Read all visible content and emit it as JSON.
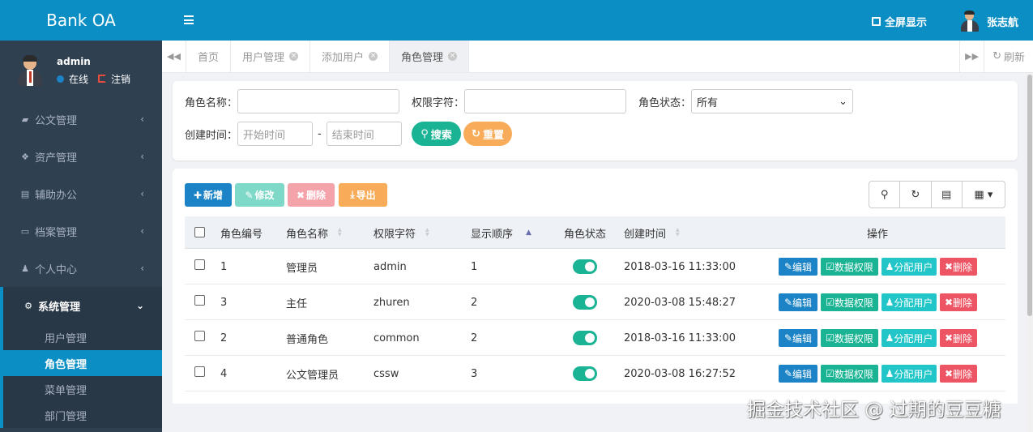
{
  "app": {
    "brand": "Bank OA"
  },
  "header": {
    "fullscreen_label": "全屏显示",
    "user_name": "张志航"
  },
  "profile": {
    "name": "admin",
    "status_online": "在线",
    "logout": "注销"
  },
  "sidebar": {
    "items": [
      {
        "label": "公文管理",
        "icon": "briefcase-icon"
      },
      {
        "label": "资产管理",
        "icon": "cubes-icon"
      },
      {
        "label": "辅助办公",
        "icon": "file-icon"
      },
      {
        "label": "档案管理",
        "icon": "inbox-icon"
      },
      {
        "label": "个人中心",
        "icon": "user-icon"
      },
      {
        "label": "系统管理",
        "icon": "gear-icon"
      }
    ],
    "subitems": [
      "用户管理",
      "角色管理",
      "菜单管理",
      "部门管理"
    ]
  },
  "tabs": [
    {
      "label": "首页"
    },
    {
      "label": "用户管理"
    },
    {
      "label": "添加用户"
    },
    {
      "label": "角色管理"
    }
  ],
  "tabs_refresh": "刷新",
  "search": {
    "role_name_label": "角色名称：",
    "role_key_label": "权限字符：",
    "status_label": "角色状态：",
    "status_value": "所有",
    "created_label": "创建时间：",
    "start_placeholder": "开始时间",
    "dash": "-",
    "end_placeholder": "结束时间",
    "search_btn": "搜索",
    "reset_btn": "重置"
  },
  "toolbar": {
    "add": "新增",
    "edit": "修改",
    "delete": "删除",
    "export": "导出"
  },
  "table": {
    "headers": [
      "角色编号",
      "角色名称",
      "权限字符",
      "显示顺序",
      "角色状态",
      "创建时间",
      "操作"
    ],
    "rows": [
      {
        "id": "1",
        "name": "管理员",
        "key": "admin",
        "sort": "1",
        "created": "2018-03-16 11:33:00"
      },
      {
        "id": "3",
        "name": "主任",
        "key": "zhuren",
        "sort": "2",
        "created": "2020-03-08 15:48:27"
      },
      {
        "id": "2",
        "name": "普通角色",
        "key": "common",
        "sort": "2",
        "created": "2018-03-16 11:33:00"
      },
      {
        "id": "4",
        "name": "公文管理员",
        "key": "cssw",
        "sort": "3",
        "created": "2020-03-08 16:27:52"
      }
    ],
    "actions": {
      "edit": "编辑",
      "data_scope": "数据权限",
      "assign_user": "分配用户",
      "delete": "删除"
    }
  },
  "watermark": "掘金技术社区 @ 过期的豆豆糖",
  "colors": {
    "primary": "#0a8ec4",
    "sidebar": "#2f4050",
    "teal": "#1ab394",
    "warning": "#f8ac59",
    "danger": "#ed5565",
    "action_blue": "#1c84c6"
  }
}
